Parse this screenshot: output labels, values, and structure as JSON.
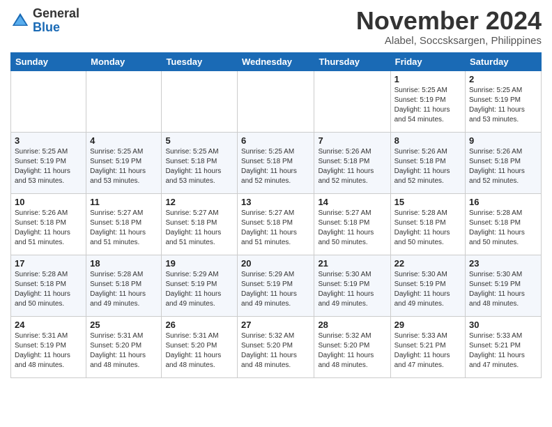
{
  "header": {
    "logo_general": "General",
    "logo_blue": "Blue",
    "month": "November 2024",
    "location": "Alabel, Soccsksargen, Philippines"
  },
  "days_of_week": [
    "Sunday",
    "Monday",
    "Tuesday",
    "Wednesday",
    "Thursday",
    "Friday",
    "Saturday"
  ],
  "weeks": [
    [
      {
        "day": "",
        "info": ""
      },
      {
        "day": "",
        "info": ""
      },
      {
        "day": "",
        "info": ""
      },
      {
        "day": "",
        "info": ""
      },
      {
        "day": "",
        "info": ""
      },
      {
        "day": "1",
        "info": "Sunrise: 5:25 AM\nSunset: 5:19 PM\nDaylight: 11 hours\nand 54 minutes."
      },
      {
        "day": "2",
        "info": "Sunrise: 5:25 AM\nSunset: 5:19 PM\nDaylight: 11 hours\nand 53 minutes."
      }
    ],
    [
      {
        "day": "3",
        "info": "Sunrise: 5:25 AM\nSunset: 5:19 PM\nDaylight: 11 hours\nand 53 minutes."
      },
      {
        "day": "4",
        "info": "Sunrise: 5:25 AM\nSunset: 5:19 PM\nDaylight: 11 hours\nand 53 minutes."
      },
      {
        "day": "5",
        "info": "Sunrise: 5:25 AM\nSunset: 5:18 PM\nDaylight: 11 hours\nand 53 minutes."
      },
      {
        "day": "6",
        "info": "Sunrise: 5:25 AM\nSunset: 5:18 PM\nDaylight: 11 hours\nand 52 minutes."
      },
      {
        "day": "7",
        "info": "Sunrise: 5:26 AM\nSunset: 5:18 PM\nDaylight: 11 hours\nand 52 minutes."
      },
      {
        "day": "8",
        "info": "Sunrise: 5:26 AM\nSunset: 5:18 PM\nDaylight: 11 hours\nand 52 minutes."
      },
      {
        "day": "9",
        "info": "Sunrise: 5:26 AM\nSunset: 5:18 PM\nDaylight: 11 hours\nand 52 minutes."
      }
    ],
    [
      {
        "day": "10",
        "info": "Sunrise: 5:26 AM\nSunset: 5:18 PM\nDaylight: 11 hours\nand 51 minutes."
      },
      {
        "day": "11",
        "info": "Sunrise: 5:27 AM\nSunset: 5:18 PM\nDaylight: 11 hours\nand 51 minutes."
      },
      {
        "day": "12",
        "info": "Sunrise: 5:27 AM\nSunset: 5:18 PM\nDaylight: 11 hours\nand 51 minutes."
      },
      {
        "day": "13",
        "info": "Sunrise: 5:27 AM\nSunset: 5:18 PM\nDaylight: 11 hours\nand 51 minutes."
      },
      {
        "day": "14",
        "info": "Sunrise: 5:27 AM\nSunset: 5:18 PM\nDaylight: 11 hours\nand 50 minutes."
      },
      {
        "day": "15",
        "info": "Sunrise: 5:28 AM\nSunset: 5:18 PM\nDaylight: 11 hours\nand 50 minutes."
      },
      {
        "day": "16",
        "info": "Sunrise: 5:28 AM\nSunset: 5:18 PM\nDaylight: 11 hours\nand 50 minutes."
      }
    ],
    [
      {
        "day": "17",
        "info": "Sunrise: 5:28 AM\nSunset: 5:18 PM\nDaylight: 11 hours\nand 50 minutes."
      },
      {
        "day": "18",
        "info": "Sunrise: 5:28 AM\nSunset: 5:18 PM\nDaylight: 11 hours\nand 49 minutes."
      },
      {
        "day": "19",
        "info": "Sunrise: 5:29 AM\nSunset: 5:19 PM\nDaylight: 11 hours\nand 49 minutes."
      },
      {
        "day": "20",
        "info": "Sunrise: 5:29 AM\nSunset: 5:19 PM\nDaylight: 11 hours\nand 49 minutes."
      },
      {
        "day": "21",
        "info": "Sunrise: 5:30 AM\nSunset: 5:19 PM\nDaylight: 11 hours\nand 49 minutes."
      },
      {
        "day": "22",
        "info": "Sunrise: 5:30 AM\nSunset: 5:19 PM\nDaylight: 11 hours\nand 49 minutes."
      },
      {
        "day": "23",
        "info": "Sunrise: 5:30 AM\nSunset: 5:19 PM\nDaylight: 11 hours\nand 48 minutes."
      }
    ],
    [
      {
        "day": "24",
        "info": "Sunrise: 5:31 AM\nSunset: 5:19 PM\nDaylight: 11 hours\nand 48 minutes."
      },
      {
        "day": "25",
        "info": "Sunrise: 5:31 AM\nSunset: 5:20 PM\nDaylight: 11 hours\nand 48 minutes."
      },
      {
        "day": "26",
        "info": "Sunrise: 5:31 AM\nSunset: 5:20 PM\nDaylight: 11 hours\nand 48 minutes."
      },
      {
        "day": "27",
        "info": "Sunrise: 5:32 AM\nSunset: 5:20 PM\nDaylight: 11 hours\nand 48 minutes."
      },
      {
        "day": "28",
        "info": "Sunrise: 5:32 AM\nSunset: 5:20 PM\nDaylight: 11 hours\nand 48 minutes."
      },
      {
        "day": "29",
        "info": "Sunrise: 5:33 AM\nSunset: 5:21 PM\nDaylight: 11 hours\nand 47 minutes."
      },
      {
        "day": "30",
        "info": "Sunrise: 5:33 AM\nSunset: 5:21 PM\nDaylight: 11 hours\nand 47 minutes."
      }
    ]
  ]
}
